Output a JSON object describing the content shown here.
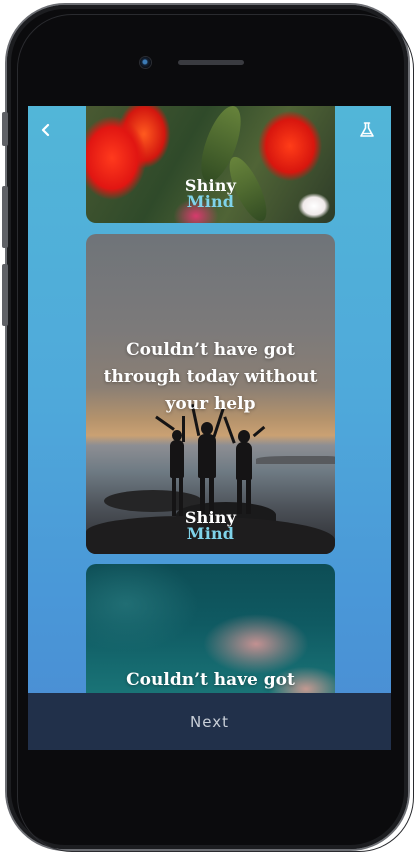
{
  "nav": {
    "back_icon": "chevron-left-icon",
    "lab_icon": "flask-icon"
  },
  "cards": [
    {
      "image": "red-tulips",
      "logo_line1": "Shiny",
      "logo_line2": "Mind"
    },
    {
      "image": "sunset-friends-silhouette",
      "message": "Couldn’t have got through today without your help",
      "logo_line1": "Shiny",
      "logo_line2": "Mind"
    },
    {
      "image": "teal-sky-pink-clouds",
      "message": "Couldn’t have got"
    }
  ],
  "footer": {
    "next_label": "Next"
  },
  "colors": {
    "background_top": "#52b6d8",
    "background_bottom": "#4b8cd3",
    "footer_bg": "#21304a",
    "logo_accent": "#7fd3ea"
  }
}
